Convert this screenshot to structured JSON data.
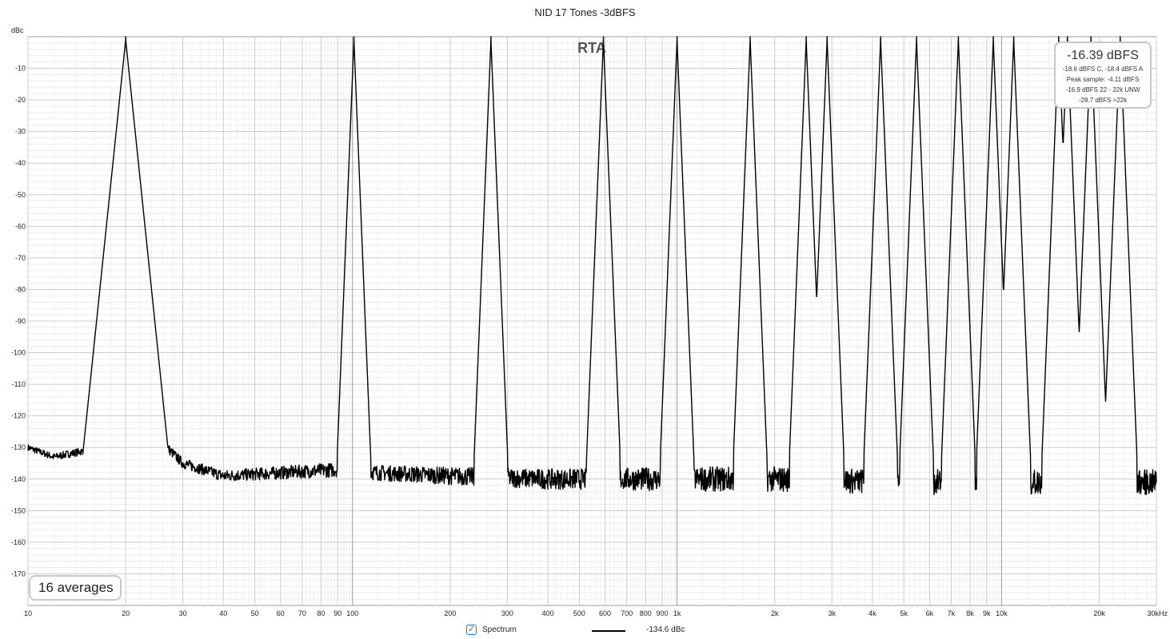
{
  "chart_data": {
    "type": "line",
    "title": "NID 17 Tones -3dBFS",
    "ylabel": "dBc",
    "xlabel": "",
    "overlay_label": "RTA",
    "x_scale": "log",
    "xlim": [
      10,
      30000
    ],
    "ylim": [
      -180,
      0
    ],
    "grid": true,
    "x_tick_labels": [
      {
        "value": 10,
        "label": "10"
      },
      {
        "value": 20,
        "label": "20"
      },
      {
        "value": 30,
        "label": "30"
      },
      {
        "value": 40,
        "label": "40"
      },
      {
        "value": 50,
        "label": "50"
      },
      {
        "value": 60,
        "label": "60"
      },
      {
        "value": 70,
        "label": "70"
      },
      {
        "value": 80,
        "label": "80"
      },
      {
        "value": 90,
        "label": "90"
      },
      {
        "value": 100,
        "label": "100"
      },
      {
        "value": 200,
        "label": "200"
      },
      {
        "value": 300,
        "label": "300"
      },
      {
        "value": 400,
        "label": "400"
      },
      {
        "value": 500,
        "label": "500"
      },
      {
        "value": 600,
        "label": "600"
      },
      {
        "value": 700,
        "label": "700"
      },
      {
        "value": 800,
        "label": "800"
      },
      {
        "value": 900,
        "label": "900"
      },
      {
        "value": 1000,
        "label": "1k"
      },
      {
        "value": 2000,
        "label": "2k"
      },
      {
        "value": 3000,
        "label": "3k"
      },
      {
        "value": 4000,
        "label": "4k"
      },
      {
        "value": 5000,
        "label": "5k"
      },
      {
        "value": 6000,
        "label": "6k"
      },
      {
        "value": 7000,
        "label": "7k"
      },
      {
        "value": 8000,
        "label": "8k"
      },
      {
        "value": 9000,
        "label": "9k"
      },
      {
        "value": 10000,
        "label": "10k"
      },
      {
        "value": 20000,
        "label": "20k"
      },
      {
        "value": 30000,
        "label": "30kHz"
      }
    ],
    "y_ticks": [
      {
        "value": -10,
        "label": "-10"
      },
      {
        "value": -20,
        "label": "-20"
      },
      {
        "value": -30,
        "label": "-30"
      },
      {
        "value": -40,
        "label": "-40"
      },
      {
        "value": -50,
        "label": "-50"
      },
      {
        "value": -60,
        "label": "-60"
      },
      {
        "value": -70,
        "label": "-70"
      },
      {
        "value": -80,
        "label": "-80"
      },
      {
        "value": -90,
        "label": "-90"
      },
      {
        "value": -100,
        "label": "-100"
      },
      {
        "value": -110,
        "label": "-110"
      },
      {
        "value": -120,
        "label": "-120"
      },
      {
        "value": -130,
        "label": "-130"
      },
      {
        "value": -140,
        "label": "-140"
      },
      {
        "value": -150,
        "label": "-150"
      },
      {
        "value": -160,
        "label": "-160"
      },
      {
        "value": -170,
        "label": "-170"
      }
    ],
    "series": [
      {
        "name": "Spectrum",
        "color": "#000000",
        "tone_frequencies_hz": [
          20,
          101,
          267,
          593,
          1000,
          1680,
          2500,
          2900,
          4240,
          5470,
          7360,
          9430,
          10900,
          15000,
          15950,
          18860,
          23200
        ],
        "tone_peak_dbc": 0,
        "noise_floor_dbc": -139,
        "envelope_points": [
          {
            "x": 10,
            "y": -130
          },
          {
            "x": 12,
            "y": -133
          },
          {
            "x": 15,
            "y": -131
          },
          {
            "x": 17,
            "y": -126
          },
          {
            "x": 18.5,
            "y": -118
          },
          {
            "x": 19.3,
            "y": -111
          },
          {
            "x": 20,
            "y": 0
          },
          {
            "x": 21,
            "y": -111
          },
          {
            "x": 22,
            "y": -118
          },
          {
            "x": 25,
            "y": -127
          },
          {
            "x": 30,
            "y": -135
          },
          {
            "x": 40,
            "y": -139
          },
          {
            "x": 60,
            "y": -138
          },
          {
            "x": 90,
            "y": -137
          },
          {
            "x": 101,
            "y": 0
          },
          {
            "x": 120,
            "y": -138
          },
          {
            "x": 200,
            "y": -139
          },
          {
            "x": 267,
            "y": 0
          },
          {
            "x": 400,
            "y": -140
          },
          {
            "x": 593,
            "y": 0
          },
          {
            "x": 800,
            "y": -140
          },
          {
            "x": 1000,
            "y": 0
          },
          {
            "x": 2000,
            "y": -140
          },
          {
            "x": 5000,
            "y": -141
          },
          {
            "x": 10000,
            "y": -141
          },
          {
            "x": 30000,
            "y": -141
          }
        ]
      }
    ]
  },
  "info_box": {
    "main": "-16.39 dBFS",
    "line1": "-18.6 dBFS C, -18.4 dBFS A",
    "line2": "Peak sample: -4.11 dBFS",
    "line3": "-16.9 dBFS 22 - 22k UNW",
    "line4": "-28.7 dBFS >22k"
  },
  "averages_label": "16 averages",
  "legend": {
    "name": "Spectrum",
    "checked": true,
    "value": "-134.6 dBc",
    "color": "#000000"
  }
}
